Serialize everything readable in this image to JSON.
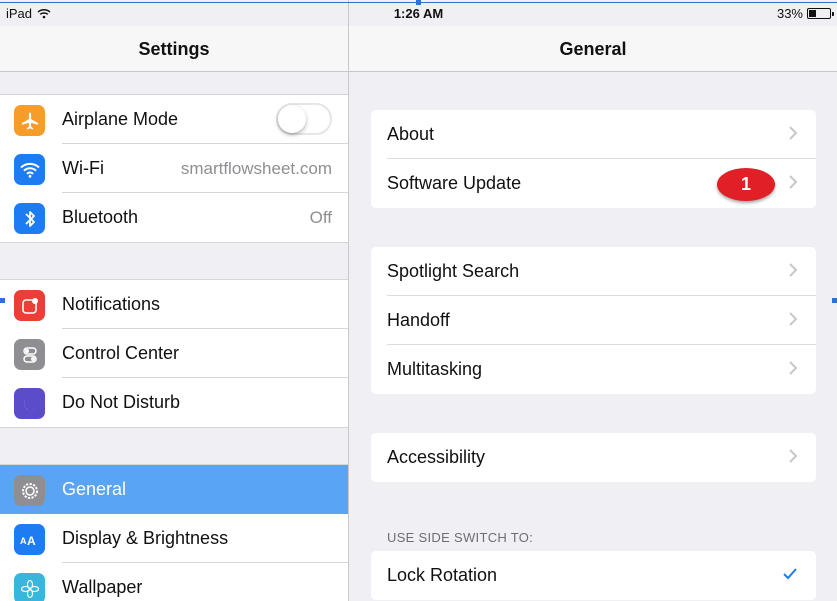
{
  "status": {
    "device": "iPad",
    "time": "1:26 AM",
    "battery": "33%",
    "battery_level": 0.33
  },
  "left_nav": {
    "title": "Settings"
  },
  "sidebar": {
    "groups": [
      [
        {
          "label": "Airplane Mode",
          "icon": "airplane-icon",
          "color": "#f59d28",
          "toggle": false
        },
        {
          "label": "Wi-Fi",
          "value": "smartflowsheet.com",
          "icon": "wifi-icon",
          "color": "#1e7cf2"
        },
        {
          "label": "Bluetooth",
          "value": "Off",
          "icon": "bluetooth-icon",
          "color": "#1e7cf2"
        }
      ],
      [
        {
          "label": "Notifications",
          "icon": "notifications-icon",
          "color": "#ea3e37"
        },
        {
          "label": "Control Center",
          "icon": "control-center-icon",
          "color": "#8e8e93"
        },
        {
          "label": "Do Not Disturb",
          "icon": "moon-icon",
          "color": "#5b4dc9"
        }
      ],
      [
        {
          "label": "General",
          "icon": "gear-icon",
          "color": "#8e8e93",
          "selected": true
        },
        {
          "label": "Display & Brightness",
          "icon": "display-icon",
          "color": "#1e7cf2"
        },
        {
          "label": "Wallpaper",
          "icon": "wallpaper-icon",
          "color": "#38b6dc"
        }
      ]
    ]
  },
  "right_nav": {
    "title": "General"
  },
  "general": {
    "groups": [
      [
        {
          "label": "About"
        },
        {
          "label": "Software Update",
          "badge": "1"
        }
      ],
      [
        {
          "label": "Spotlight Search"
        },
        {
          "label": "Handoff"
        },
        {
          "label": "Multitasking"
        }
      ],
      [
        {
          "label": "Accessibility"
        }
      ]
    ],
    "section_header": "USE SIDE SWITCH TO:",
    "side_switch": [
      {
        "label": "Lock Rotation",
        "checked": true
      }
    ]
  },
  "colors": {
    "accent": "#1e7cf2",
    "badge": "#e01f26",
    "selected_row": "#5aa4f5"
  }
}
